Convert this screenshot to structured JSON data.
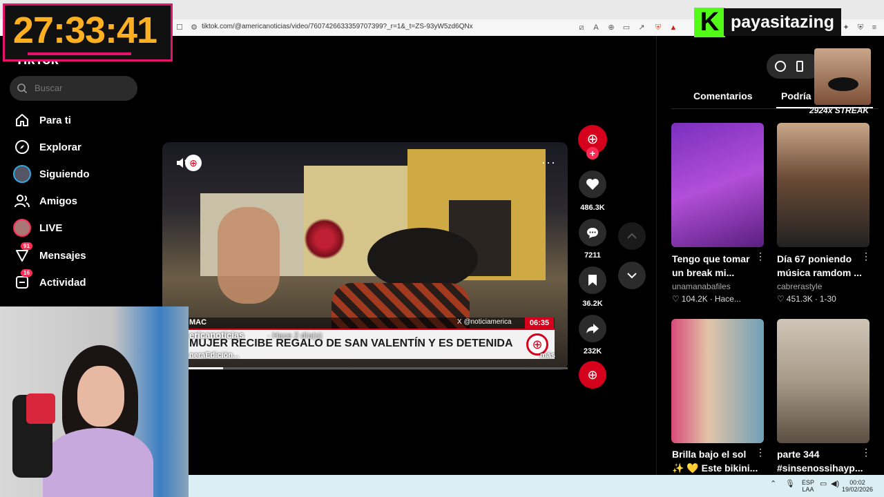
{
  "browser": {
    "url": "tiktok.com/@americanoticias/video/7607426633359707399?_r=1&_t=ZS-93yW5zd6QNx"
  },
  "overlay": {
    "timer": "27:33:41",
    "channel_name": "payasitazing",
    "streak_text": "2924x STREAK"
  },
  "sidebar": {
    "logo": "TikTok",
    "search_placeholder": "Buscar",
    "items": [
      {
        "label": "Para ti"
      },
      {
        "label": "Explorar"
      },
      {
        "label": "Siguiendo"
      },
      {
        "label": "Amigos"
      },
      {
        "label": "LIVE"
      },
      {
        "label": "Mensajes",
        "badge": "91"
      },
      {
        "label": "Actividad",
        "badge": "16"
      }
    ]
  },
  "video": {
    "ticker_left": "MAC",
    "ticker_handle": "X @noticiamerica",
    "ticker_time": "06:35",
    "headline": "MUJER RECIBE REGALO DE SAN VALENTÍN Y ES DETENIDA",
    "author": "ericanoticias",
    "posted": "· Hace 2 día(s)",
    "caption": "neraEdición...",
    "more": "más",
    "progress": 0.15
  },
  "actions": {
    "likes": "486.3K",
    "comments": "7211",
    "saves": "36.2K",
    "shares": "232K"
  },
  "right_panel": {
    "tabs": [
      "Comentarios",
      "Podría i"
    ],
    "cards": [
      {
        "title": "Tengo que tomar un break mi...",
        "author": "unamanabafiles",
        "likes": "104.2K",
        "date": "Hace..."
      },
      {
        "title": "Día 67 poniendo música ramdom ...",
        "author": "cabrerastyle",
        "likes": "451.3K",
        "date": "1-30"
      },
      {
        "title": "Brilla bajo el sol",
        "subtitle": "✨ 💛 Este bikini..."
      },
      {
        "title": "parte 344",
        "subtitle": "#sinsenossihayp..."
      }
    ]
  },
  "taskbar": {
    "lang": "ESP",
    "lang2": "LAA",
    "time": "00:02",
    "date": "19/02/2026"
  },
  "colors": {
    "accent": "#fe2c55",
    "news_red": "#d5001c",
    "kick_green": "#53fc18"
  }
}
